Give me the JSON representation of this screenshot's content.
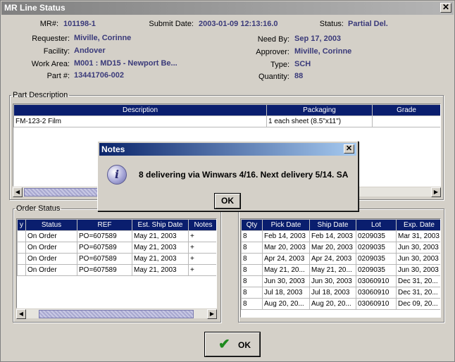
{
  "window": {
    "title": "MR Line Status",
    "close_glyph": "✕"
  },
  "header": {
    "mr_label": "MR#:",
    "mr_value": "101198-1",
    "submit_label": "Submit Date:",
    "submit_value": "2003-01-09 12:13:16.0",
    "status_label": "Status:",
    "status_value": "Partial Del.",
    "requester_label": "Requester:",
    "requester_value": "Miville, Corinne",
    "needby_label": "Need By:",
    "needby_value": "Sep 17, 2003",
    "facility_label": "Facility:",
    "facility_value": "Andover",
    "approver_label": "Approver:",
    "approver_value": "Miville, Corinne",
    "workarea_label": "Work Area:",
    "workarea_value": "M001 : MD15 - Newport Be...",
    "type_label": "Type:",
    "type_value": "SCH",
    "part_label": "Part #:",
    "part_value": "13441706-002",
    "quantity_label": "Quantity:",
    "quantity_value": "88"
  },
  "part_description": {
    "legend": "Part Description",
    "columns": [
      "Description",
      "Packaging",
      "Grade"
    ],
    "rows": [
      [
        "FM-123-2 Film",
        "1 each sheet (8.5\"x11\")",
        ""
      ]
    ]
  },
  "order_status": {
    "legend": "Order Status",
    "left_columns": [
      "y",
      "Status",
      "REF",
      "Est. Ship Date",
      "Notes"
    ],
    "left_rows": [
      [
        "",
        "On Order",
        "PO=607589",
        "May 21, 2003",
        "+"
      ],
      [
        "",
        "On Order",
        "PO=607589",
        "May 21, 2003",
        "+"
      ],
      [
        "",
        "On Order",
        "PO=607589",
        "May 21, 2003",
        "+"
      ],
      [
        "",
        "On Order",
        "PO=607589",
        "May 21, 2003",
        "+"
      ]
    ],
    "right_columns": [
      "Qty",
      "Pick Date",
      "Ship Date",
      "Lot",
      "Exp. Date"
    ],
    "right_rows": [
      [
        "8",
        "Feb 14, 2003",
        "Feb 14, 2003",
        "0209035",
        "Mar 31, 2003"
      ],
      [
        "8",
        "Mar 20, 2003",
        "Mar 20, 2003",
        "0209035",
        "Jun 30, 2003"
      ],
      [
        "8",
        "Apr 24, 2003",
        "Apr 24, 2003",
        "0209035",
        "Jun 30, 2003"
      ],
      [
        "8",
        "May 21, 20...",
        "May 21, 20...",
        "0209035",
        "Jun 30, 2003"
      ],
      [
        "8",
        "Jun 30, 2003",
        "Jun 30, 2003",
        "03060910",
        "Dec 31, 20..."
      ],
      [
        "8",
        "Jul 18, 2003",
        "Jul 18, 2003",
        "03060910",
        "Dec 31, 20..."
      ],
      [
        "8",
        "Aug 20, 20...",
        "Aug 20, 20...",
        "03060910",
        "Dec 09, 20..."
      ]
    ]
  },
  "footer": {
    "ok_label": "OK",
    "ok_icon": "✔"
  },
  "dialog": {
    "title": "Notes",
    "close_glyph": "✕",
    "icon_glyph": "i",
    "message": "8 delivering via Winwars 4/16.  Next delivery 5/14.  SA",
    "ok_label": "OK"
  },
  "scroll": {
    "left_arrow": "◀",
    "right_arrow": "▶"
  }
}
